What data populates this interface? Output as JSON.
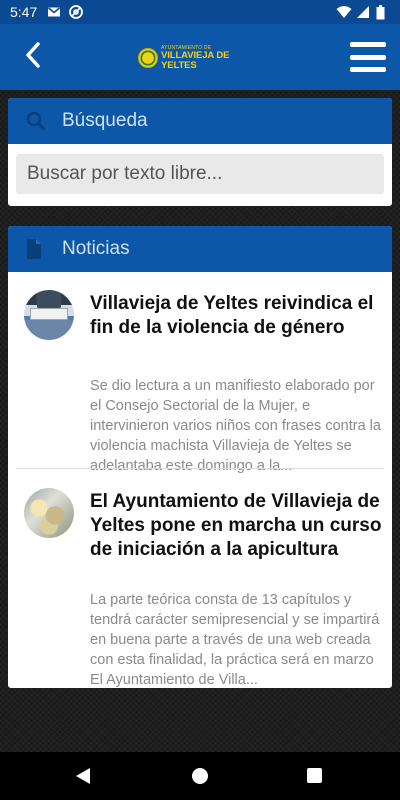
{
  "status_bar": {
    "time": "5:47",
    "icons": [
      "gmail-icon",
      "at-sign-icon",
      "wifi-icon",
      "signal-icon",
      "battery-icon"
    ]
  },
  "app_bar": {
    "back_icon": "chevron-left-icon",
    "logo": {
      "small_text": "AYUNTAMIENTO DE",
      "big_text": "VILLAVIEJA DE YELTES"
    },
    "menu_icon": "hamburger-menu-icon",
    "colors": {
      "primary": "#0d57a8",
      "logo_yellow": "#f4d21a"
    }
  },
  "search": {
    "header_label": "Búsqueda",
    "header_icon": "search-icon",
    "placeholder": "Buscar por texto libre..."
  },
  "news": {
    "header_label": "Noticias",
    "header_icon": "document-icon",
    "items": [
      {
        "title": "Villavieja de Yeltes reivindica el fin de la violencia de género",
        "excerpt": "Se dio lectura a un manifiesto elaborado por el Consejo Sectorial de la Mujer, e intervinieron varios niños con frases contra la violencia machista Villavieja de Yeltes se adelantaba este domingo a la..."
      },
      {
        "title": "El Ayuntamiento de Villavieja de Yeltes pone en marcha un curso de iniciación a la apicultura",
        "excerpt": "La parte teórica consta de 13 capítulos y tendrá carácter semipresencial y se impartirá en buena parte a través de una web creada con esta finalidad, la práctica será en marzo El Ayuntamiento de Villa..."
      }
    ]
  },
  "nav_bar": {
    "buttons": [
      "back-triangle-icon",
      "home-circle-icon",
      "recents-square-icon"
    ]
  }
}
